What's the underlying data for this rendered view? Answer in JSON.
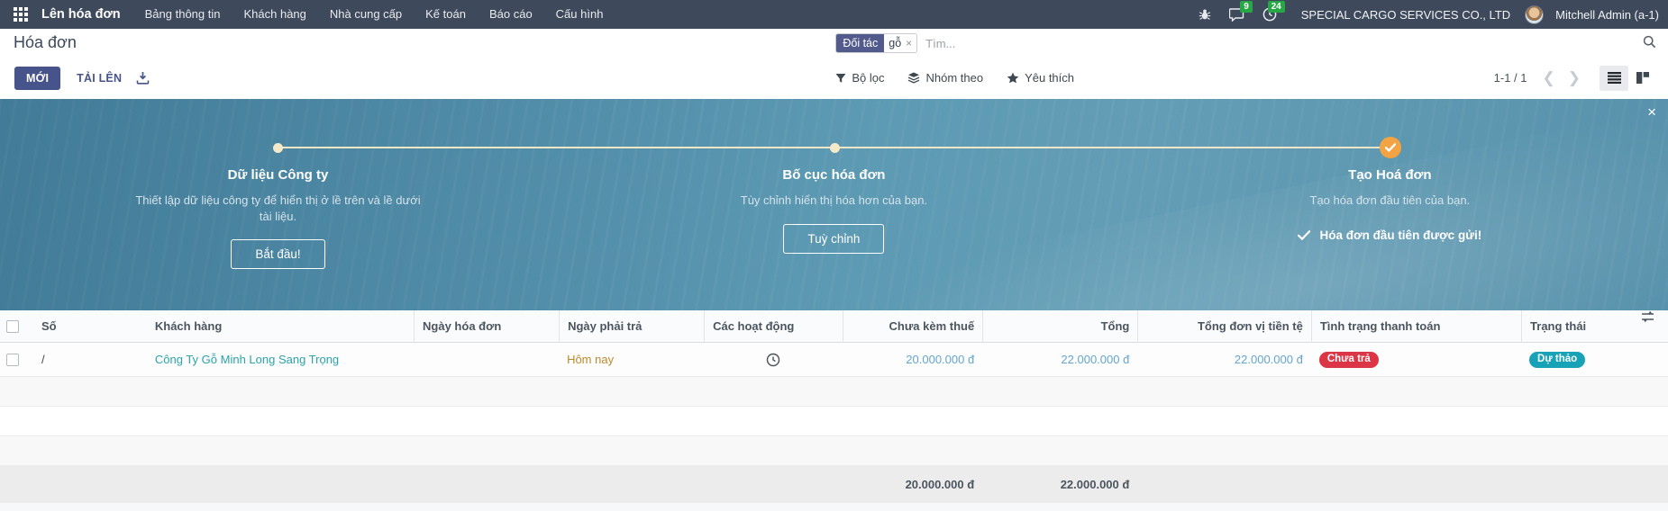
{
  "topbar": {
    "app_name": "Lên hóa đơn",
    "menus": [
      "Bảng thông tin",
      "Khách hàng",
      "Nhà cung cấp",
      "Kế toán",
      "Báo cáo",
      "Cấu hình"
    ],
    "message_badge": "9",
    "activity_badge": "24",
    "company": "SPECIAL CARGO SERVICES CO., LTD",
    "user": "Mitchell Admin (a-1)"
  },
  "control": {
    "title": "Hóa đơn",
    "search": {
      "facet_label": "Đối tác",
      "facet_value": "gỗ",
      "remove_glyph": "×",
      "placeholder": "Tìm..."
    },
    "new_label": "MỚI",
    "upload_label": "TẢI LÊN",
    "filter_label": "Bộ lọc",
    "group_by_label": "Nhóm theo",
    "favorites_label": "Yêu thích",
    "pagination": {
      "range": "1-1 / 1",
      "prev_glyph": "❮",
      "next_glyph": "❯"
    }
  },
  "banner": {
    "close_glyph": "×",
    "steps": [
      {
        "title": "Dữ liệu Công ty",
        "description": "Thiết lập dữ liệu công ty để hiển thị ở lề trên và lề dưới tài liệu.",
        "button": "Bắt đầu!"
      },
      {
        "title": "Bố cục hóa đơn",
        "description": "Tùy chỉnh hiển thị hóa hơn của bạn.",
        "button": "Tuỳ chỉnh"
      },
      {
        "title": "Tạo Hoá đơn",
        "description": "Tạo hóa đơn đầu tiên của bạn.",
        "done_note": "Hóa đơn đầu tiên được gửi!"
      }
    ]
  },
  "table": {
    "headers": [
      "Số",
      "Khách hàng",
      "Ngày hóa đơn",
      "Ngày phải trả",
      "Các hoạt động",
      "Chưa kèm thuế",
      "Tổng",
      "Tổng đơn vị tiền tệ",
      "Tình trạng thanh toán",
      "Trạng thái"
    ],
    "rows": [
      {
        "number": "/",
        "customer": "Công Ty Gỗ Minh Long Sang Trọng",
        "invoice_date": "",
        "due_date": "Hôm nay",
        "untaxed": "20.000.000 đ",
        "total": "22.000.000 đ",
        "total_currency": "22.000.000 đ",
        "payment_status": "Chưa trả",
        "status": "Dự thảo"
      }
    ],
    "footer": {
      "untaxed_total": "20.000.000 đ",
      "total": "22.000.000 đ"
    }
  },
  "colors": {
    "topbar_bg": "#3e4a5c",
    "primary_indigo": "#47548b",
    "facet_bg": "#525b8c",
    "banner_teal": "#5791ab",
    "timeline_cream": "#f3e7c8",
    "done_orange": "#f3a342",
    "link_teal": "#2ba3a8",
    "amount_blue": "#64a5cd",
    "due_warning": "#bd8a2b",
    "badge_red": "#dc3545",
    "badge_teal": "#17a2b8",
    "notif_green": "#28a745"
  }
}
